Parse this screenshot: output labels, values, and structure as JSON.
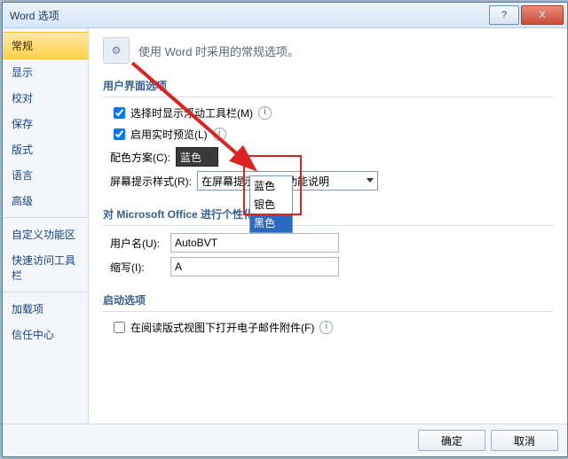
{
  "window": {
    "title": "Word 选项"
  },
  "winbuttons": {
    "min": "–",
    "help": "?",
    "close": "X"
  },
  "sidebar": {
    "items": [
      {
        "label": "常规"
      },
      {
        "label": "显示"
      },
      {
        "label": "校对"
      },
      {
        "label": "保存"
      },
      {
        "label": "版式"
      },
      {
        "label": "语言"
      },
      {
        "label": "高级"
      }
    ],
    "items2": [
      {
        "label": "自定义功能区"
      },
      {
        "label": "快速访问工具栏"
      }
    ],
    "items3": [
      {
        "label": "加载项"
      },
      {
        "label": "信任中心"
      }
    ]
  },
  "header": {
    "icon": "⚙",
    "text": "使用 Word 时采用的常规选项。"
  },
  "section1": {
    "title": "用户界面选项",
    "opt1": "选择时显示浮动工具栏(M)",
    "opt2": "启用实时预览(L)",
    "color_label": "配色方案(C):",
    "color_value": "蓝色",
    "tooltip_label": "屏幕提示样式(R):",
    "tooltip_value": "在屏幕提示中显示功能说明",
    "dropdown": {
      "o0": "蓝色",
      "o1": "银色",
      "o2": "黑色"
    }
  },
  "section2": {
    "title": "对 Microsoft Office 进行个性化设置",
    "user_label": "用户名(U):",
    "user_value": "AutoBVT",
    "init_label": "缩写(I):",
    "init_value": "A"
  },
  "section3": {
    "title": "启动选项",
    "opt1": "在阅读版式视图下打开电子邮件附件(F)"
  },
  "footer": {
    "ok": "确定",
    "cancel": "取消"
  }
}
